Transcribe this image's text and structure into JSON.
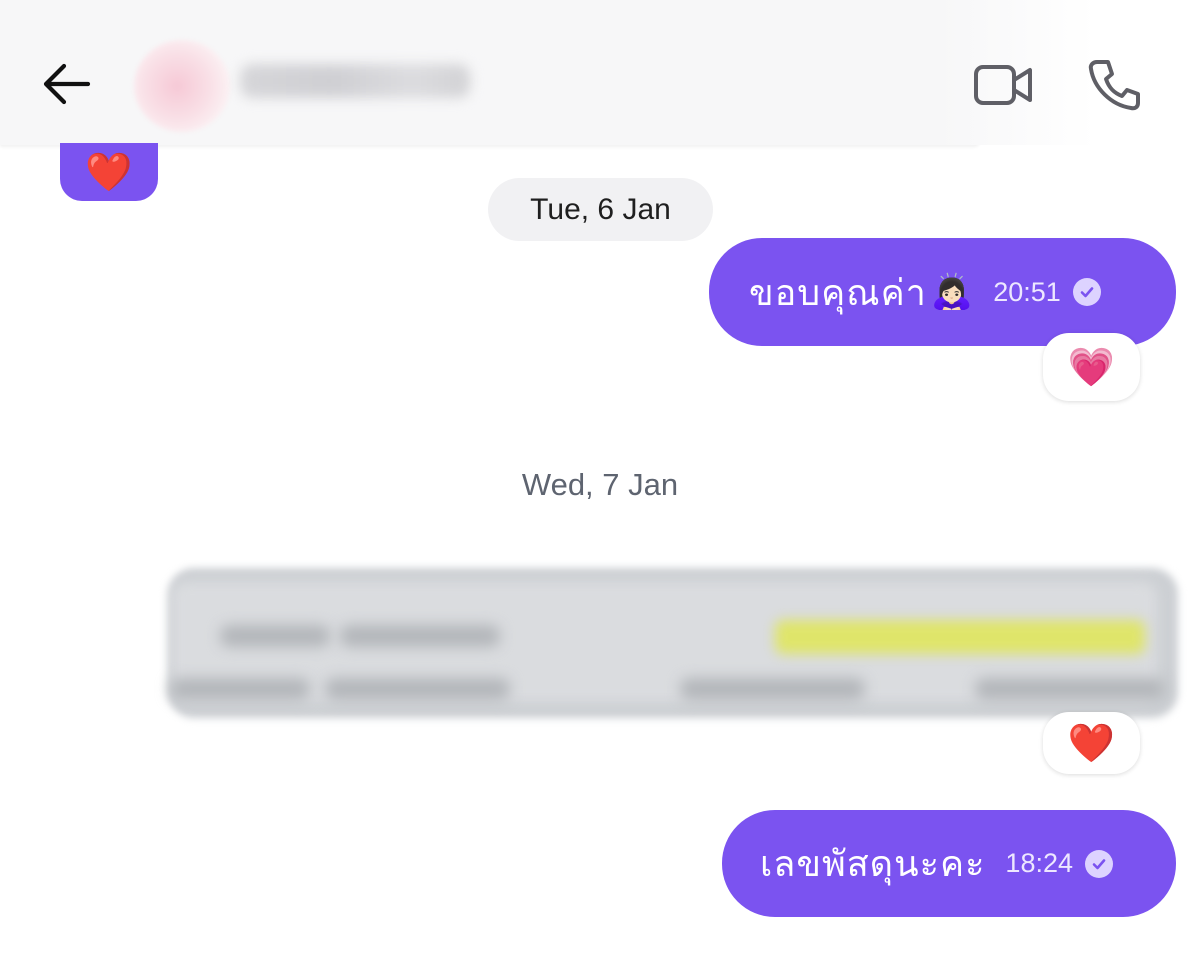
{
  "header": {
    "contact_name_blurred": true
  },
  "colors": {
    "accent": "#7b53f0",
    "date_chip_bg": "#f1f1f3",
    "date_text_muted": "#5e6470"
  },
  "conversation": {
    "top_reaction": "❤️",
    "days": [
      {
        "label": "Tue, 6 Jan",
        "messages": [
          {
            "text": "ขอบคุณค่า",
            "emoji": "🙇🏻‍♀️",
            "time": "20:51",
            "status": "read",
            "reaction": "💗"
          }
        ]
      },
      {
        "label": "Wed, 7 Jan",
        "messages": [
          {
            "type": "attachment",
            "blurred": true,
            "reaction": "❤️"
          },
          {
            "text": "เลขพัสดุนะคะ",
            "time": "18:24",
            "status": "read"
          }
        ]
      }
    ]
  }
}
